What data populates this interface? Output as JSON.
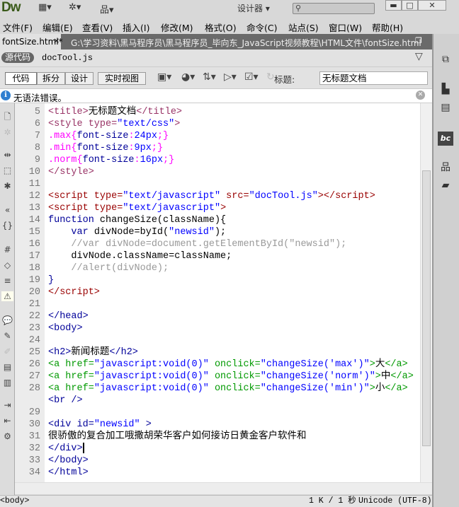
{
  "app": {
    "logo": "Dw",
    "workspace": "设计器",
    "search_placeholder": ""
  },
  "menu": [
    "文件(F)",
    "编辑(E)",
    "查看(V)",
    "插入(I)",
    "修改(M)",
    "格式(O)",
    "命令(C)",
    "站点(S)",
    "窗口(W)",
    "帮助(H)"
  ],
  "tab": {
    "label": "fontSize.html*",
    "close": "×",
    "path": "G:\\学习资料\\黑马程序员\\黑马程序员_毕向东_JavaScript视频教程\\HTML文件\\fontSize.html"
  },
  "related": {
    "source": "源代码",
    "file": "docTool.js"
  },
  "toolbar": {
    "views": [
      "代码",
      "拆分",
      "设计",
      "实时视图"
    ],
    "title_label": "标题:",
    "title_value": "无标题文档"
  },
  "info": {
    "message": "无语法错误。"
  },
  "status": {
    "tag": "<body>",
    "size": "1 K / 1 秒",
    "encoding": "Unicode (UTF-8)"
  },
  "colors": {
    "plain": "#000000",
    "style": "#993366",
    "script": "#990000",
    "a": "#009900",
    "tag": "#000099",
    "val": "#0000ff",
    "css": "#ff00ff",
    "prop": "#000099",
    "kw": "#000099",
    "cmt": "#999999"
  },
  "code": [
    {
      "n": "5",
      "t": [
        [
          "<title>",
          "style"
        ],
        [
          "无标题文档",
          "plain"
        ],
        [
          "</title>",
          "style"
        ]
      ]
    },
    {
      "n": "6",
      "t": [
        [
          "<style type=",
          "style"
        ],
        [
          "\"text/css\"",
          "val"
        ],
        [
          ">",
          "style"
        ]
      ]
    },
    {
      "n": "7",
      "t": [
        [
          ".max{",
          "css"
        ],
        [
          "font-size",
          "prop"
        ],
        [
          ":",
          "css"
        ],
        [
          "24px",
          "val"
        ],
        [
          ";}",
          "css"
        ]
      ]
    },
    {
      "n": "8",
      "t": [
        [
          ".min{",
          "css"
        ],
        [
          "font-size",
          "prop"
        ],
        [
          ":",
          "css"
        ],
        [
          "9px",
          "val"
        ],
        [
          ";}",
          "css"
        ]
      ]
    },
    {
      "n": "9",
      "t": [
        [
          ".norm{",
          "css"
        ],
        [
          "font-size",
          "prop"
        ],
        [
          ":",
          "css"
        ],
        [
          "16px",
          "val"
        ],
        [
          ";}",
          "css"
        ]
      ]
    },
    {
      "n": "10",
      "t": [
        [
          "</style>",
          "style"
        ]
      ]
    },
    {
      "n": "11",
      "t": []
    },
    {
      "n": "12",
      "t": [
        [
          "<script type=",
          "script"
        ],
        [
          "\"text/javascript\"",
          "val"
        ],
        [
          " src=",
          "script"
        ],
        [
          "\"docTool.js\"",
          "val"
        ],
        [
          "></script>",
          "script"
        ]
      ]
    },
    {
      "n": "13",
      "t": [
        [
          "<script type=",
          "script"
        ],
        [
          "\"text/javascript\"",
          "val"
        ],
        [
          ">",
          "script"
        ]
      ]
    },
    {
      "n": "14",
      "t": [
        [
          "function",
          "kw"
        ],
        [
          " changeSize(className){",
          "plain"
        ]
      ]
    },
    {
      "n": "15",
      "t": [
        [
          "    ",
          "plain"
        ],
        [
          "var",
          "kw"
        ],
        [
          " divNode=byId(",
          "plain"
        ],
        [
          "\"newsid\"",
          "val"
        ],
        [
          ");",
          "plain"
        ]
      ]
    },
    {
      "n": "16",
      "t": [
        [
          "    //var divNode=document.getElementById(\"newsid\");",
          "cmt"
        ]
      ]
    },
    {
      "n": "17",
      "t": [
        [
          "    divNode.className=className;",
          "plain"
        ]
      ]
    },
    {
      "n": "18",
      "t": [
        [
          "    //alert(divNode);",
          "cmt"
        ]
      ]
    },
    {
      "n": "19",
      "t": [
        [
          "}",
          "tag"
        ]
      ]
    },
    {
      "n": "20",
      "t": [
        [
          "</script>",
          "script"
        ]
      ]
    },
    {
      "n": "21",
      "t": []
    },
    {
      "n": "22",
      "t": [
        [
          "</head>",
          "tag"
        ]
      ]
    },
    {
      "n": "23",
      "t": [
        [
          "<body>",
          "tag"
        ]
      ]
    },
    {
      "n": "24",
      "t": []
    },
    {
      "n": "25",
      "t": [
        [
          "<h2>",
          "tag"
        ],
        [
          "新闻标题",
          "plain"
        ],
        [
          "</h2>",
          "tag"
        ]
      ]
    },
    {
      "n": "26",
      "t": [
        [
          "<a href=",
          "a"
        ],
        [
          "\"javascript:void(0)\"",
          "val"
        ],
        [
          " onclick=",
          "a"
        ],
        [
          "\"changeSize('max')\"",
          "val"
        ],
        [
          ">",
          "a"
        ],
        [
          "大",
          "plain"
        ],
        [
          "</a>",
          "a"
        ]
      ]
    },
    {
      "n": "27",
      "t": [
        [
          "<a href=",
          "a"
        ],
        [
          "\"javascript:void(0)\"",
          "val"
        ],
        [
          " onclick=",
          "a"
        ],
        [
          "\"changeSize('norm')\"",
          "val"
        ],
        [
          ">",
          "a"
        ],
        [
          "中",
          "plain"
        ],
        [
          "</a>",
          "a"
        ]
      ]
    },
    {
      "n": "28",
      "t": [
        [
          "<a href=",
          "a"
        ],
        [
          "\"javascript:void(0)\"",
          "val"
        ],
        [
          " onclick=",
          "a"
        ],
        [
          "\"changeSize('min')\"",
          "val"
        ],
        [
          ">",
          "a"
        ],
        [
          "小",
          "plain"
        ],
        [
          "</a>",
          "a"
        ]
      ]
    },
    {
      "n": "",
      "t": [
        [
          "<br />",
          "tag"
        ]
      ]
    },
    {
      "n": "29",
      "t": []
    },
    {
      "n": "30",
      "t": [
        [
          "<div id=",
          "tag"
        ],
        [
          "\"newsid\"",
          "val"
        ],
        [
          " >",
          "tag"
        ]
      ]
    },
    {
      "n": "31",
      "t": [
        [
          "很骄傲的复合加工哦撒胡荣华客户如何接访日黄金客户软件和",
          "plain"
        ]
      ]
    },
    {
      "n": "32",
      "t": [
        [
          "</div>",
          "tag"
        ]
      ]
    },
    {
      "n": "33",
      "t": [
        [
          "</body>",
          "tag"
        ]
      ]
    },
    {
      "n": "34",
      "t": [
        [
          "</html>",
          "tag"
        ]
      ]
    }
  ]
}
